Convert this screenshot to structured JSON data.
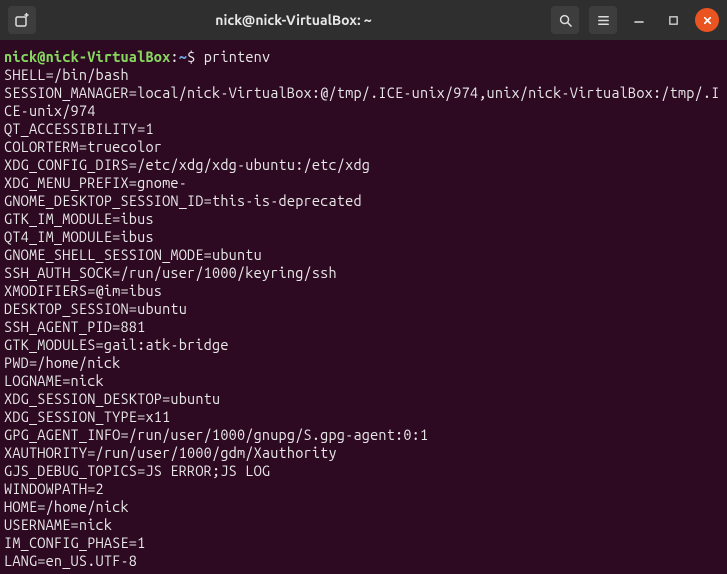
{
  "header": {
    "title": "nick@nick-VirtualBox: ~"
  },
  "prompt": {
    "user": "nick",
    "at": "@",
    "host": "nick-VirtualBox",
    "colon": ":",
    "path": "~",
    "dollar": "$"
  },
  "command": "printenv",
  "output": [
    "SHELL=/bin/bash",
    "SESSION_MANAGER=local/nick-VirtualBox:@/tmp/.ICE-unix/974,unix/nick-VirtualBox:/tmp/.ICE-unix/974",
    "QT_ACCESSIBILITY=1",
    "COLORTERM=truecolor",
    "XDG_CONFIG_DIRS=/etc/xdg/xdg-ubuntu:/etc/xdg",
    "XDG_MENU_PREFIX=gnome-",
    "GNOME_DESKTOP_SESSION_ID=this-is-deprecated",
    "GTK_IM_MODULE=ibus",
    "QT4_IM_MODULE=ibus",
    "GNOME_SHELL_SESSION_MODE=ubuntu",
    "SSH_AUTH_SOCK=/run/user/1000/keyring/ssh",
    "XMODIFIERS=@im=ibus",
    "DESKTOP_SESSION=ubuntu",
    "SSH_AGENT_PID=881",
    "GTK_MODULES=gail:atk-bridge",
    "PWD=/home/nick",
    "LOGNAME=nick",
    "XDG_SESSION_DESKTOP=ubuntu",
    "XDG_SESSION_TYPE=x11",
    "GPG_AGENT_INFO=/run/user/1000/gnupg/S.gpg-agent:0:1",
    "XAUTHORITY=/run/user/1000/gdm/Xauthority",
    "GJS_DEBUG_TOPICS=JS ERROR;JS LOG",
    "WINDOWPATH=2",
    "HOME=/home/nick",
    "USERNAME=nick",
    "IM_CONFIG_PHASE=1",
    "LANG=en_US.UTF-8"
  ],
  "icons": {
    "new_tab": "new-tab",
    "search": "search",
    "menu": "menu",
    "minimize": "minimize",
    "maximize": "maximize",
    "close": "close"
  }
}
